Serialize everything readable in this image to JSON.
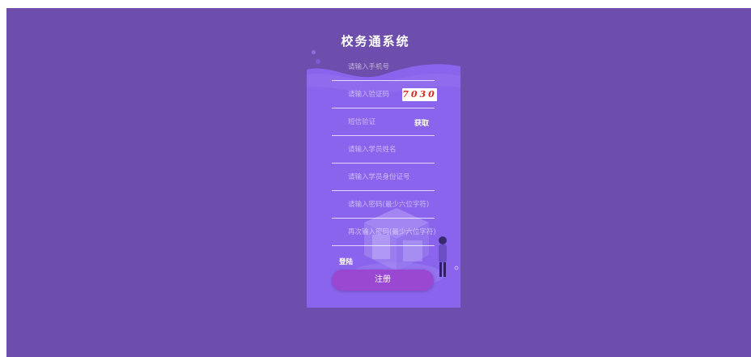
{
  "title": "校务通系统",
  "fields": {
    "phone": {
      "placeholder": "请输入手机号"
    },
    "captcha": {
      "placeholder": "请输入验证码",
      "code": "7030"
    },
    "sms": {
      "placeholder": "短信验证",
      "get_label": "获取"
    },
    "student_name": {
      "placeholder": "请输入学员姓名"
    },
    "student_id": {
      "placeholder": "请输入学员身份证号"
    },
    "password": {
      "placeholder": "请输入密码(最少六位字符)"
    },
    "password_confirm": {
      "placeholder": "再次输入密码(最少六位字符)"
    }
  },
  "login_label": "登陆",
  "register_label": "注册",
  "colors": {
    "page_bg": "#6e4ead",
    "card_bg": "#8a64ec",
    "button": "#9a47d1",
    "captcha_text": "#d62a1f"
  }
}
